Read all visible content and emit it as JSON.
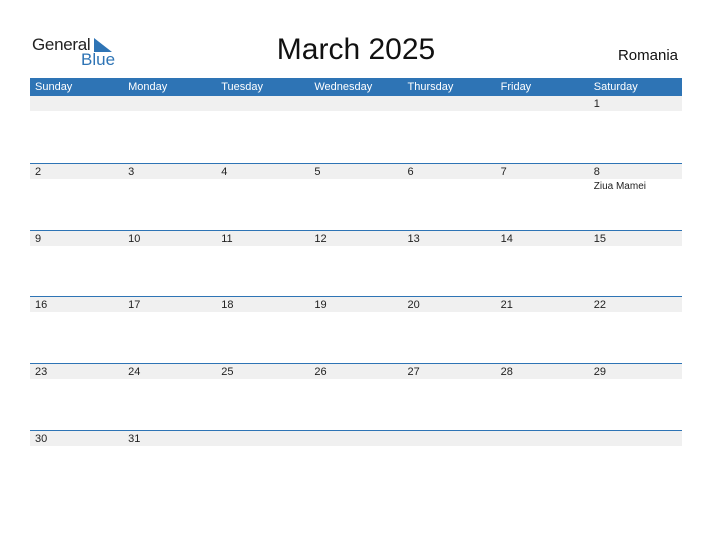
{
  "logo": {
    "line1": "General",
    "line2": "Blue"
  },
  "title": "March 2025",
  "country": "Romania",
  "weekdays": [
    "Sunday",
    "Monday",
    "Tuesday",
    "Wednesday",
    "Thursday",
    "Friday",
    "Saturday"
  ],
  "weeks": [
    [
      {
        "d": ""
      },
      {
        "d": ""
      },
      {
        "d": ""
      },
      {
        "d": ""
      },
      {
        "d": ""
      },
      {
        "d": ""
      },
      {
        "d": "1"
      }
    ],
    [
      {
        "d": "2"
      },
      {
        "d": "3"
      },
      {
        "d": "4"
      },
      {
        "d": "5"
      },
      {
        "d": "6"
      },
      {
        "d": "7"
      },
      {
        "d": "8",
        "event": "Ziua Mamei"
      }
    ],
    [
      {
        "d": "9"
      },
      {
        "d": "10"
      },
      {
        "d": "11"
      },
      {
        "d": "12"
      },
      {
        "d": "13"
      },
      {
        "d": "14"
      },
      {
        "d": "15"
      }
    ],
    [
      {
        "d": "16"
      },
      {
        "d": "17"
      },
      {
        "d": "18"
      },
      {
        "d": "19"
      },
      {
        "d": "20"
      },
      {
        "d": "21"
      },
      {
        "d": "22"
      }
    ],
    [
      {
        "d": "23"
      },
      {
        "d": "24"
      },
      {
        "d": "25"
      },
      {
        "d": "26"
      },
      {
        "d": "27"
      },
      {
        "d": "28"
      },
      {
        "d": "29"
      }
    ],
    [
      {
        "d": "30"
      },
      {
        "d": "31"
      },
      {
        "d": ""
      },
      {
        "d": ""
      },
      {
        "d": ""
      },
      {
        "d": ""
      },
      {
        "d": ""
      }
    ]
  ],
  "colors": {
    "accent": "#2e74b5",
    "band": "#f0f0f0"
  }
}
